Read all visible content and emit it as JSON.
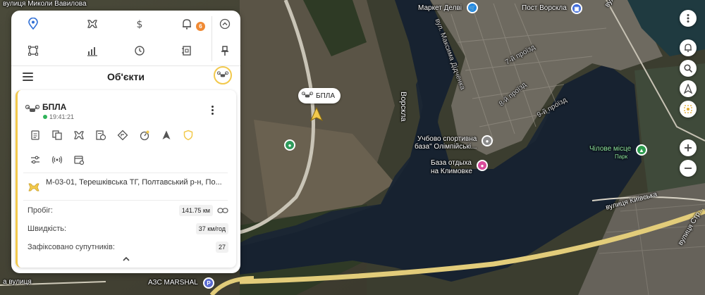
{
  "panel": {
    "title": "Об'єкти",
    "notifications_count": "6",
    "toolbar_icons": [
      "location-pin-icon",
      "drone-icon",
      "dollar-icon",
      "bell-icon",
      "collapse-icon",
      "geofence-icon",
      "chart-icon",
      "history-icon",
      "report-icon",
      "pin-icon"
    ]
  },
  "unit": {
    "name": "БПЛА",
    "time": "19:41:21",
    "address": "М-03-01, Терешківська ТГ, Полтавський р-н, По...",
    "stats": [
      {
        "label": "Пробіг:",
        "value": "141.75 км"
      },
      {
        "label": "Швидкість:",
        "value": "37 км/год"
      },
      {
        "label": "Зафіксовано супутників:",
        "value": "27"
      }
    ],
    "status_color": "#2fb35a",
    "accent_color": "#f2c94c"
  },
  "map": {
    "vehicle_label": "БПЛА",
    "labels": {
      "market": "Маркет Делві",
      "post": "Пост Ворскла",
      "street_maksyma": "вул. Максима Дідченка",
      "street_vorskla": "вулиця Ворскла",
      "river": "Ворскла",
      "proizd7": "7-й проїзд",
      "proizd8": "8-й проїзд",
      "proizd9": "9-й проїзд",
      "sport_base_1": "Учбово спортивна",
      "sport_base_2": "база\" Олімпійські...",
      "rest_base_1": "База отдыха",
      "rest_base_2": "на Климовке",
      "chilove": "Чілове місце",
      "park": "Парк",
      "kyivska": "вулиця Київська",
      "azs": "АЗС MARSHAL",
      "vulytsia": "а вулиця",
      "mykoly": "вулиця Миколи Вавилова",
      "street_right": "вулиця Стр..."
    }
  }
}
